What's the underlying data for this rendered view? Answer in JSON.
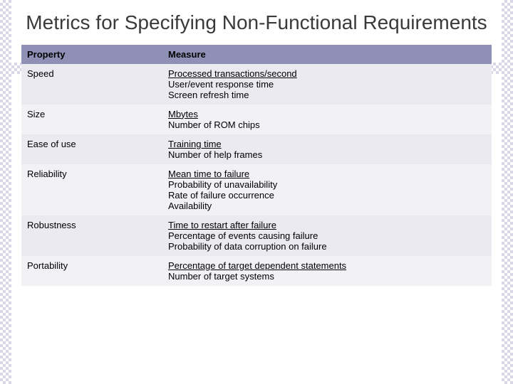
{
  "title": "Metrics for Specifying Non-Functional Requirements",
  "headers": {
    "property": "Property",
    "measure": "Measure"
  },
  "rows": [
    {
      "property": "Speed",
      "measures": [
        "Processed transactions/second",
        "User/event response time",
        "Screen refresh time"
      ]
    },
    {
      "property": "Size",
      "measures": [
        "Mbytes",
        "Number of ROM chips"
      ]
    },
    {
      "property": "Ease of use",
      "measures": [
        "Training time",
        "Number of help frames"
      ]
    },
    {
      "property": "Reliability",
      "measures": [
        "Mean time to failure",
        "Probability of unavailability",
        "Rate of failure occurrence",
        "Availability"
      ]
    },
    {
      "property": "Robustness",
      "measures": [
        "Time to restart after failure",
        "Percentage of events causing failure",
        "Probability of data corruption on failure"
      ]
    },
    {
      "property": "Portability",
      "measures": [
        "Percentage of target dependent statements",
        "Number of target systems"
      ]
    }
  ]
}
